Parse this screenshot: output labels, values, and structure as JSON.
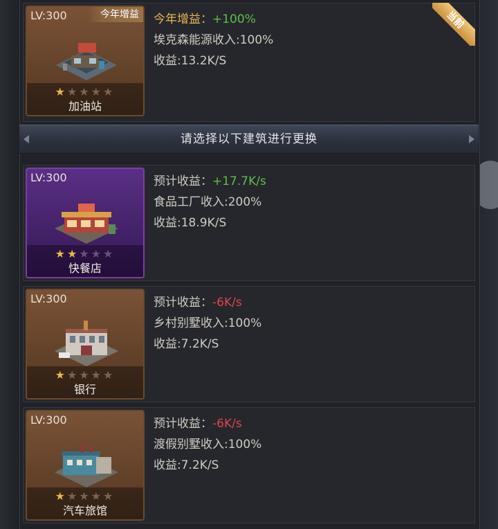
{
  "current": {
    "level": "LV:300",
    "tag": "今年增益",
    "corner_label": "当前",
    "stars": 1,
    "name": "加油站",
    "line1_label": "今年增益：",
    "line1_value": "+100%",
    "line2": "埃克森能源收入:100%",
    "line3": "收益:13.2K/S"
  },
  "divider_text": "请选择以下建筑进行更换",
  "options": [
    {
      "level": "LV:300",
      "stars": 2,
      "rarity": "purple",
      "name": "快餐店",
      "line1_label": "预计收益：",
      "line1_value": "+17.7K/s",
      "line1_color": "#5fbf4a",
      "line2": "食品工厂收入:200%",
      "line3": "收益:18.9K/S"
    },
    {
      "level": "LV:300",
      "stars": 1,
      "rarity": "brown",
      "name": "银行",
      "line1_label": "预计收益：",
      "line1_value": "-6K/s",
      "line1_color": "#e0454a",
      "line2": "乡村别墅收入:100%",
      "line3": "收益:7.2K/S"
    },
    {
      "level": "LV:300",
      "stars": 1,
      "rarity": "brown",
      "name": "汽车旅馆",
      "line1_label": "预计收益：",
      "line1_value": "-6K/s",
      "line1_color": "#e0454a",
      "line2": "渡假别墅收入:100%",
      "line3": "收益:7.2K/S"
    }
  ]
}
